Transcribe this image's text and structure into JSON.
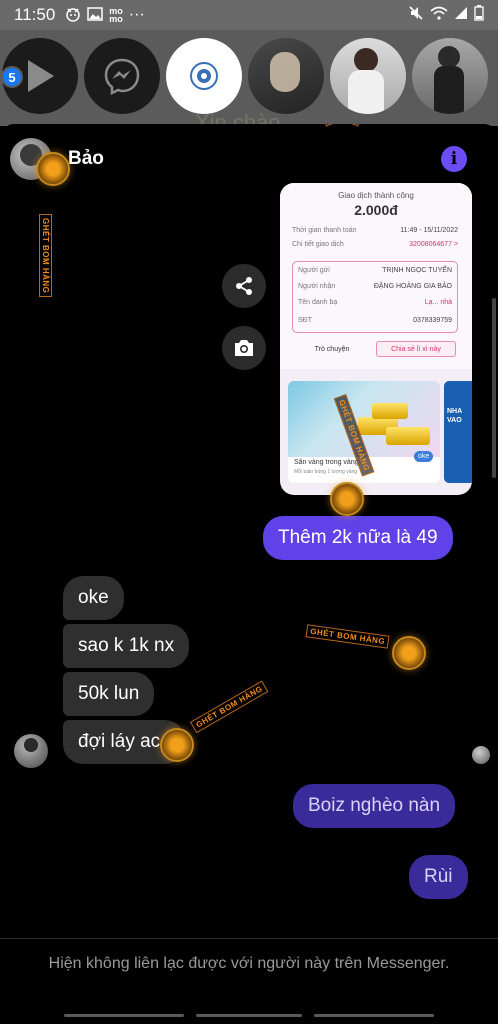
{
  "status_bar": {
    "time": "11:50",
    "left_icons": [
      "sticker-icon",
      "image-icon",
      "momo-icon",
      "more-icon"
    ],
    "momo_label": "mo\nmo",
    "more_label": "···",
    "right_icons": [
      "mute-icon",
      "wifi-icon",
      "signal-icon",
      "battery-icon"
    ]
  },
  "chat_heads": {
    "count_badge": "5",
    "background_text": "Xin chào"
  },
  "header": {
    "name": "Bảo",
    "info_label": "i"
  },
  "receipt": {
    "title": "Giao dịch thành công",
    "amount": "2.000đ",
    "rows": [
      {
        "label": "Thời gian thanh toán",
        "value": "11:49 - 15/11/2022"
      },
      {
        "label": "Chi tiết giao dịch",
        "value": "32008064677 >"
      },
      {
        "label": "Người gửi",
        "value": "TRỊNH NGỌC TUYẾN"
      },
      {
        "label": "Người nhận",
        "value": "ĐẶNG HOÀNG GIA BẢO"
      },
      {
        "label": "Tên danh bạ",
        "value": "Lạ... nhà"
      },
      {
        "label": "SĐT",
        "value": "0378339759"
      }
    ],
    "chat_button": "Trò chuyện",
    "share_button": "Chia sẻ lì xì này",
    "banner_title": "Săn vàng trong vàng",
    "banner_subtitle": "Mỗi tuần trúng 1 lượng vàng",
    "side_text": "NHA\nVAO",
    "oke_label": "oke"
  },
  "messages": [
    {
      "id": "m1",
      "text": "Thêm 2k nữa là 49",
      "direction": "out"
    },
    {
      "id": "m2",
      "text": "oke",
      "direction": "in"
    },
    {
      "id": "m3",
      "text": "sao k 1k nx",
      "direction": "in"
    },
    {
      "id": "m4",
      "text": "50k lun",
      "direction": "in"
    },
    {
      "id": "m5",
      "text": "đợi láy acc",
      "direction": "in"
    },
    {
      "id": "m6",
      "text": "Boiz nghèo nàn",
      "direction": "out"
    },
    {
      "id": "m7",
      "text": "Rùi",
      "direction": "out"
    }
  ],
  "watermark": {
    "text": "GHÉT BOM HÀNG"
  },
  "footer": {
    "notice": "Hiện không liên lạc được với người này trên Messenger."
  },
  "colors": {
    "outgoing_bubble": "#5f43e8",
    "incoming_bubble": "#2f2f2f",
    "accent": "#6c4cf5",
    "background": "#000000"
  }
}
